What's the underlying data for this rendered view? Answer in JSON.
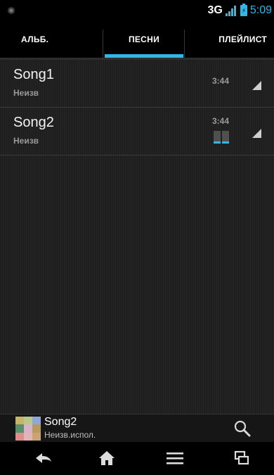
{
  "status": {
    "network": "3G",
    "battery_glyph": "⚡",
    "time": "5:09"
  },
  "tabs": [
    {
      "label": "АЛЬБ."
    },
    {
      "label": "ПЕСНИ",
      "selected": true
    },
    {
      "label": "ПЛЕЙЛИСТ"
    }
  ],
  "songs": [
    {
      "title": "Song1",
      "artist": "Неизв",
      "duration": "3:44",
      "playing": false
    },
    {
      "title": "Song2",
      "artist": "Неизв",
      "duration": "3:44",
      "playing": true
    }
  ],
  "now_playing": {
    "title": "Song2",
    "artist": "Неизв.испол."
  },
  "icons": {
    "status_left": "settings-dot-icon",
    "signal": "signal-icon",
    "battery": "battery-charging-icon",
    "song_menu": "overflow-triangle-icon",
    "equalizer": "equalizer-icon",
    "search": "search-icon",
    "back": "back-icon",
    "home": "home-icon",
    "menu": "menu-icon",
    "recents": "recent-apps-icon"
  },
  "colors": {
    "accent": "#33b5e5",
    "background": "#000000",
    "list_bg": "#202020"
  }
}
